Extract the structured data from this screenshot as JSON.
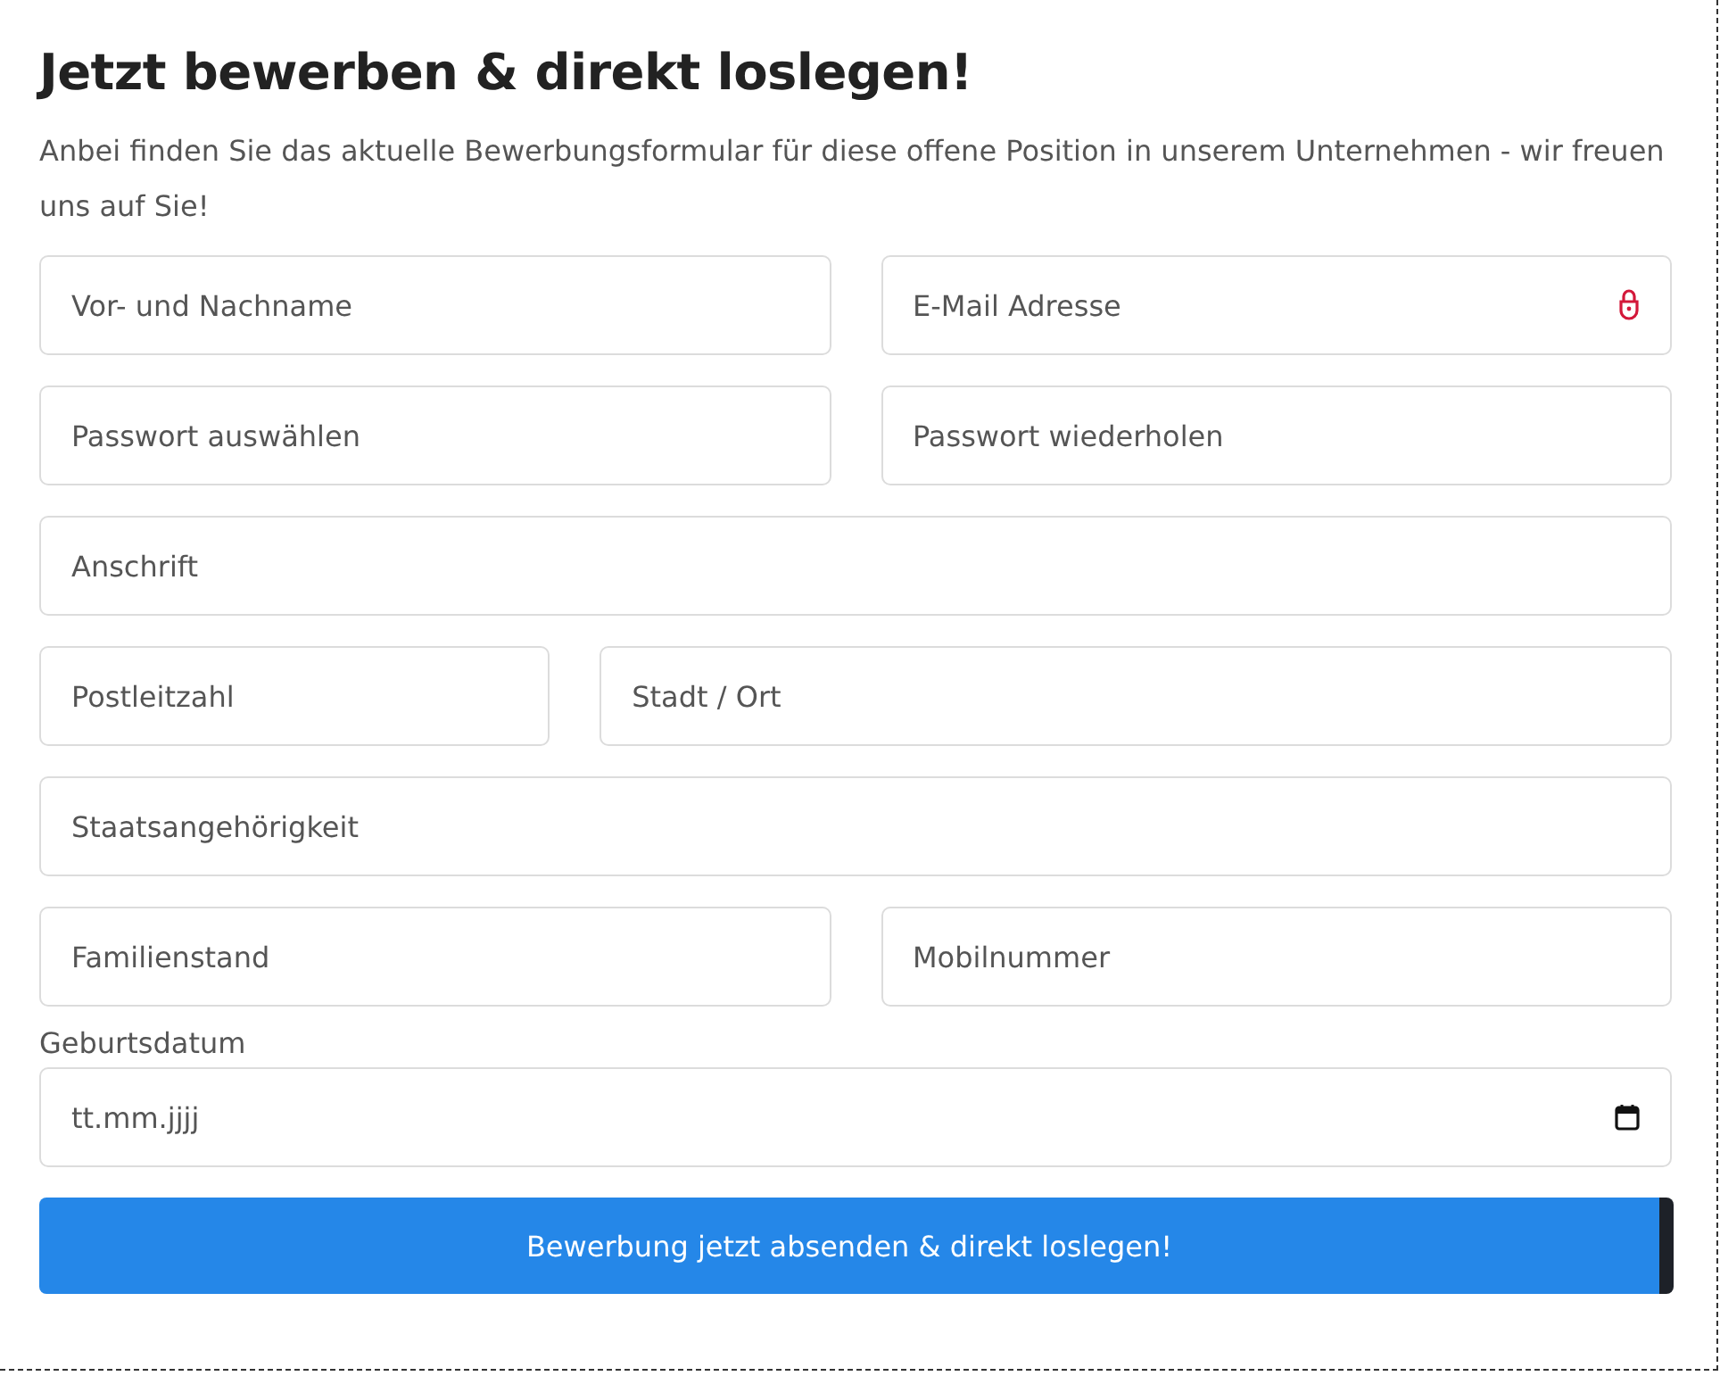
{
  "title": "Jetzt bewerben & direkt loslegen!",
  "intro": "Anbei finden Sie das aktuelle Bewerbungsformular für diese offene Position in unserem Unternehmen - wir freuen uns auf Sie!",
  "rows": [
    {
      "kind": "pair",
      "fields": [
        {
          "kind": "text",
          "placeholder": "Vor- und Nachname"
        },
        {
          "kind": "email",
          "placeholder": "E-Mail Adresse"
        }
      ]
    },
    {
      "kind": "pair",
      "fields": [
        {
          "kind": "text",
          "placeholder": "Passwort auswählen"
        },
        {
          "kind": "text",
          "placeholder": "Passwort wiederholen"
        }
      ]
    },
    {
      "kind": "single",
      "fields": [
        {
          "kind": "text",
          "placeholder": "Anschrift"
        }
      ]
    },
    {
      "kind": "short-long",
      "fields": [
        {
          "kind": "text",
          "placeholder": "Postleitzahl"
        },
        {
          "kind": "text",
          "placeholder": "Stadt / Ort"
        }
      ]
    },
    {
      "kind": "single",
      "fields": [
        {
          "kind": "text",
          "placeholder": "Staatsangehörigkeit"
        }
      ]
    },
    {
      "kind": "pair",
      "fields": [
        {
          "kind": "text",
          "placeholder": "Familienstand"
        },
        {
          "kind": "text",
          "placeholder": "Mobilnummer"
        }
      ]
    },
    {
      "kind": "single",
      "label": "Geburtsdatum",
      "fields": [
        {
          "kind": "date",
          "placeholder": "tt.mm.jjjj"
        }
      ]
    }
  ],
  "submit": "Bewerbung jetzt absenden & direkt loslegen!"
}
